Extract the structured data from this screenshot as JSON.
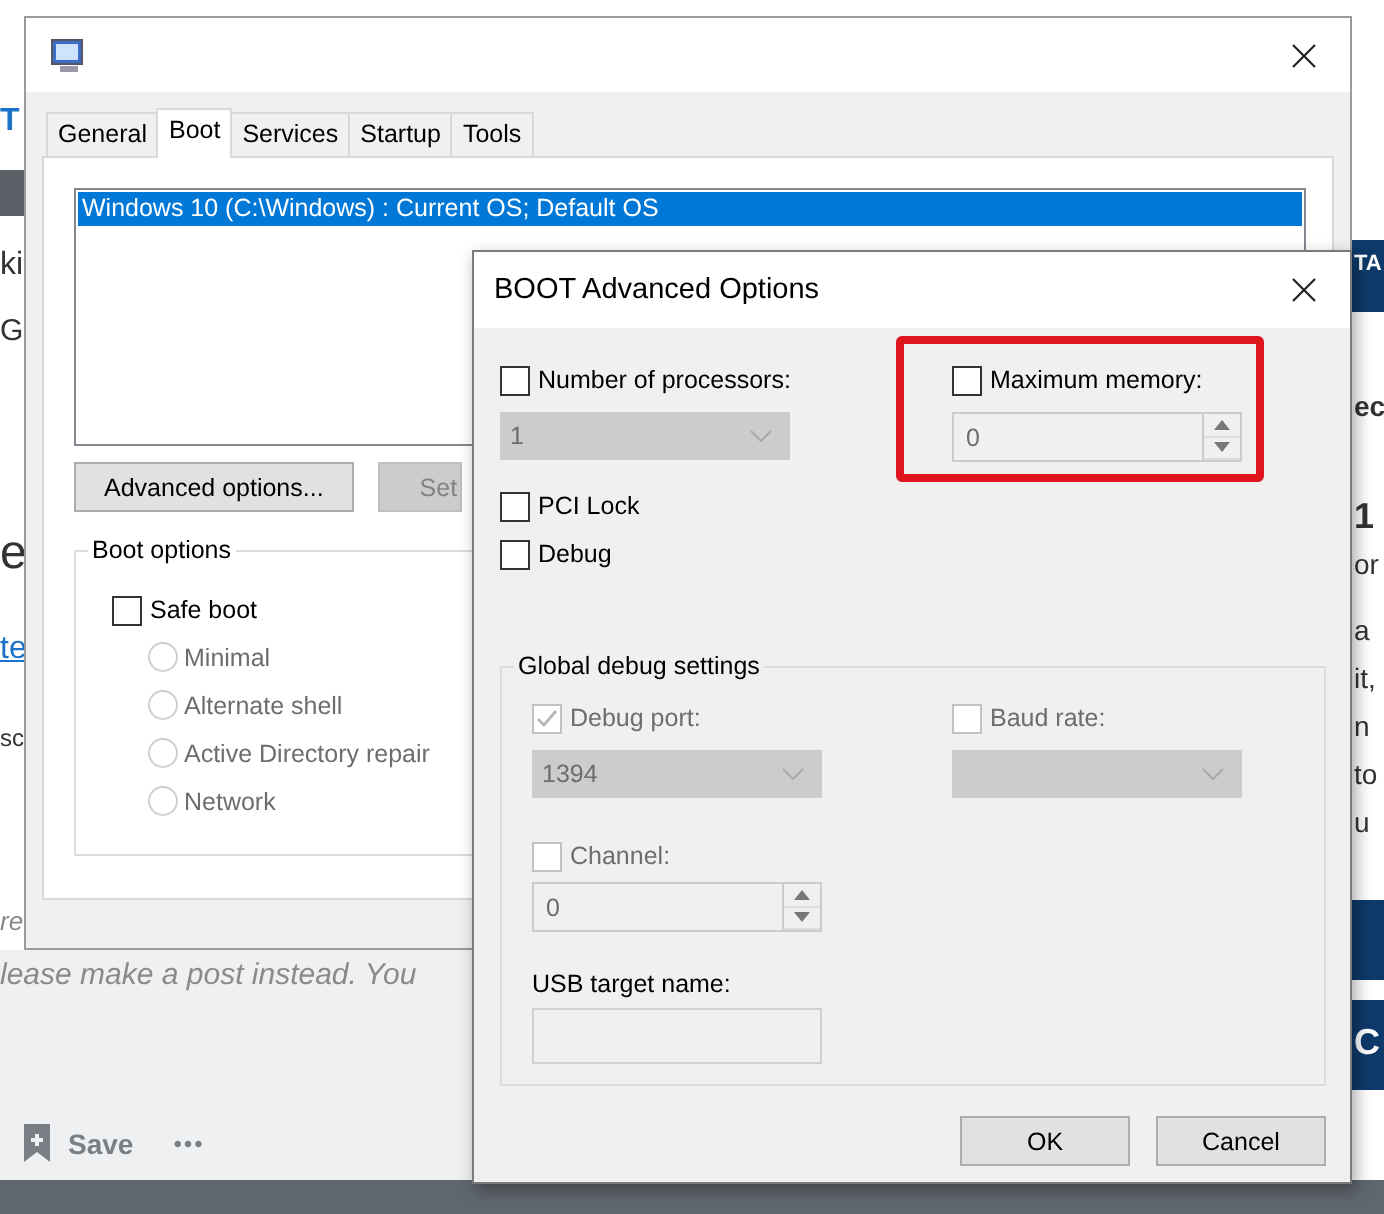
{
  "background_page": {
    "left_fragments": [
      {
        "text": "T",
        "kind": "link"
      },
      {
        "text": "ki",
        "kind": "text"
      },
      {
        "text": "G",
        "kind": "heading"
      },
      {
        "text": "e",
        "kind": "title"
      },
      {
        "text": "te",
        "kind": "link"
      },
      {
        "text": "sc",
        "kind": "small"
      },
      {
        "text": "re",
        "kind": "hint"
      }
    ],
    "comment_hint": "lease make a post instead. You",
    "save_label": "Save",
    "more_label": "•••",
    "right_fragments": [
      {
        "text": "TA",
        "kind": "banner"
      },
      {
        "text": "ec",
        "kind": "bold"
      },
      {
        "text": "1",
        "kind": "big"
      },
      {
        "text": "or",
        "kind": "text"
      },
      {
        "text": "a",
        "kind": "text"
      },
      {
        "text": "it,",
        "kind": "text"
      },
      {
        "text": "n",
        "kind": "text"
      },
      {
        "text": "to",
        "kind": "text"
      },
      {
        "text": "u",
        "kind": "text"
      },
      {
        "text": "C",
        "kind": "banner"
      }
    ]
  },
  "system_config": {
    "tabs": [
      {
        "label": "General",
        "selected": false
      },
      {
        "label": "Boot",
        "selected": true
      },
      {
        "label": "Services",
        "selected": false
      },
      {
        "label": "Startup",
        "selected": false
      },
      {
        "label": "Tools",
        "selected": false
      }
    ],
    "boot_entries": [
      {
        "text": "Windows 10 (C:\\Windows) : Current OS; Default OS",
        "selected": true
      }
    ],
    "buttons": [
      {
        "label": "Advanced options...",
        "disabled": false
      },
      {
        "label": "Set",
        "disabled": true
      }
    ],
    "boot_options": {
      "title": "Boot options",
      "safe_boot": {
        "label": "Safe boot",
        "checked": false
      },
      "modes": [
        {
          "label": "Minimal",
          "selected": false,
          "disabled": true
        },
        {
          "label": "Alternate shell",
          "selected": false,
          "disabled": true
        },
        {
          "label": "Active Directory repair",
          "selected": false,
          "disabled": true
        },
        {
          "label": "Network",
          "selected": false,
          "disabled": true
        }
      ]
    }
  },
  "advanced_dialog": {
    "title": "BOOT Advanced Options",
    "number_of_processors": {
      "label": "Number of processors:",
      "checked": false,
      "value": "1",
      "disabled": true
    },
    "maximum_memory": {
      "label": "Maximum memory:",
      "checked": false,
      "value": "0",
      "disabled": true,
      "highlighted": true
    },
    "pci_lock": {
      "label": "PCI Lock",
      "checked": false
    },
    "debug": {
      "label": "Debug",
      "checked": false
    },
    "global_debug": {
      "title": "Global debug settings",
      "debug_port": {
        "label": "Debug port:",
        "checked": true,
        "disabled": true,
        "value": "1394"
      },
      "baud_rate": {
        "label": "Baud rate:",
        "checked": false,
        "disabled": true
      },
      "channel": {
        "label": "Channel:",
        "checked": false,
        "disabled": true,
        "value": "0"
      },
      "usb_target_name": {
        "label": "USB target name:",
        "disabled": true
      }
    },
    "buttons": [
      {
        "label": "OK"
      },
      {
        "label": "Cancel"
      }
    ]
  }
}
